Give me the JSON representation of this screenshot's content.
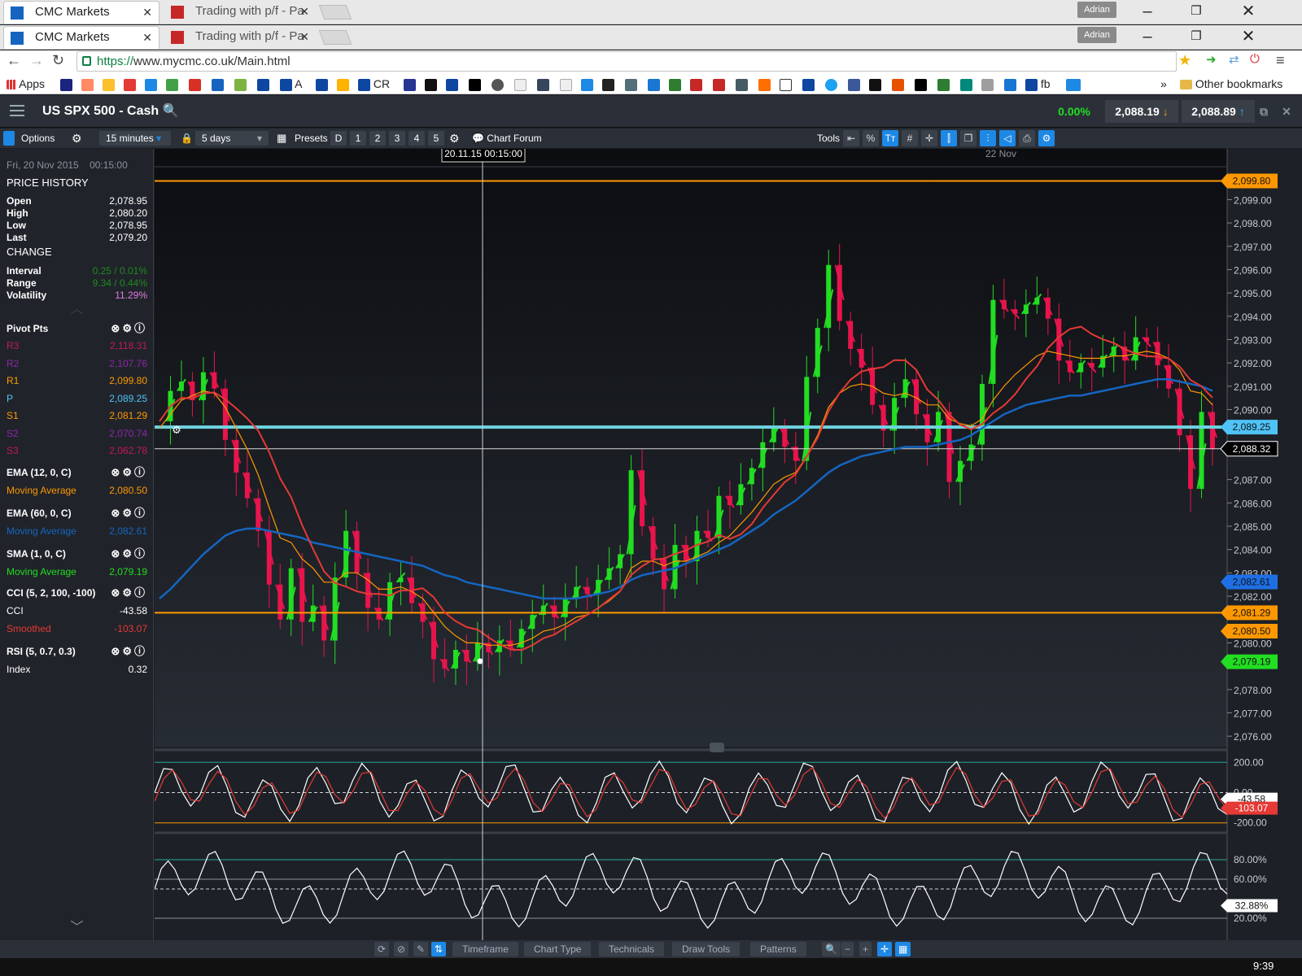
{
  "browser": {
    "tabs_top": [
      {
        "label": "CMC Markets",
        "active": true
      },
      {
        "label": "Trading with p/f - Pa",
        "active": false
      }
    ],
    "tabs_second": [
      {
        "label": "CMC Markets",
        "active": true
      },
      {
        "label": "Trading with p/f - Pa",
        "active": false
      }
    ],
    "user_badge": "Adrian",
    "url_scheme": "https://",
    "url_rest": "www.mycmc.co.uk/Main.html",
    "bookmarks": {
      "apps_label": "Apps",
      "a_label": "A",
      "cr_label": "CR",
      "fb_label": "fb",
      "more": "»",
      "other": "Other bookmarks"
    }
  },
  "app": {
    "instrument": "US SPX 500 - Cash",
    "change_pct": "0.00%",
    "sell_price": "2,088.19",
    "buy_price": "2,088.89",
    "colors": {
      "accent": "#1e88e5",
      "up": "#22dd22",
      "down": "#e8144c"
    }
  },
  "toolbar": {
    "options": "Options",
    "interval": "15 minutes",
    "range": "5 days",
    "presets": "Presets",
    "preset_buttons": [
      "D",
      "1",
      "2",
      "3",
      "4",
      "5"
    ],
    "chart_forum": "Chart Forum",
    "tools": "Tools"
  },
  "sidebar": {
    "date": "Fri, 20 Nov 2015",
    "time": "00:15:00",
    "price_history": "PRICE HISTORY",
    "ohlc": [
      {
        "label": "Open",
        "value": "2,078.95"
      },
      {
        "label": "High",
        "value": "2,080.20"
      },
      {
        "label": "Low",
        "value": "2,078.95"
      },
      {
        "label": "Last",
        "value": "2,079.20"
      }
    ],
    "change": "CHANGE",
    "stats": [
      {
        "label": "Interval",
        "value": "0.25 / 0.01%",
        "color": "#1f8a1f"
      },
      {
        "label": "Range",
        "value": "9.34 / 0.44%",
        "color": "#1f8a1f"
      },
      {
        "label": "Volatility",
        "value": "11.29%",
        "color": "#e07ae0"
      }
    ],
    "pivot_title": "Pivot Pts",
    "pivots": [
      {
        "label": "R3",
        "value": "2,118.31",
        "color": "#c2185b"
      },
      {
        "label": "R2",
        "value": "2,107.76",
        "color": "#8e24aa"
      },
      {
        "label": "R1",
        "value": "2,099.80",
        "color": "#ff9800"
      },
      {
        "label": "P",
        "value": "2,089.25",
        "color": "#4fc3f7"
      },
      {
        "label": "S1",
        "value": "2,081.29",
        "color": "#ff9800"
      },
      {
        "label": "S2",
        "value": "2,070.74",
        "color": "#8e24aa"
      },
      {
        "label": "S3",
        "value": "2,062.78",
        "color": "#c2185b"
      }
    ],
    "indicators": [
      {
        "title": "EMA (12, 0, C)",
        "label": "Moving Average",
        "value": "2,080.50",
        "color": "#ff9800"
      },
      {
        "title": "EMA (60, 0, C)",
        "label": "Moving Average",
        "value": "2,082.61",
        "color": "#1565c0"
      },
      {
        "title": "SMA (1, 0, C)",
        "label": "Moving Average",
        "value": "2,079.19",
        "color": "#22dd22"
      },
      {
        "title": "CCI (5, 2, 100, -100)",
        "label": "CCI",
        "value": "-43.58",
        "color": "#ffffff",
        "label2": "Smoothed",
        "value2": "-103.07",
        "color2": "#e53935"
      },
      {
        "title": "RSI (5, 0.7, 0.3)",
        "label": "Index",
        "value": "0.32",
        "color": "#ffffff"
      }
    ]
  },
  "chart_data": {
    "type": "line",
    "price_axis": [
      "2,099.00",
      "2,098.00",
      "2,097.00",
      "2,096.00",
      "2,095.00",
      "2,094.00",
      "2,093.00",
      "2,092.00",
      "2,091.00",
      "2,090.00",
      "2,087.00",
      "2,086.00",
      "2,085.00",
      "2,084.00",
      "2,083.00",
      "2,082.00",
      "2,080.00",
      "2,078.00",
      "2,077.00",
      "2,076.00"
    ],
    "ylim": [
      2075.9,
      2100.2
    ],
    "crosshair_label": "20.11.15 00:15:00",
    "day_label": "22 Nov",
    "price_tags": [
      {
        "value": "2,099.80",
        "price": 2099.8,
        "color": "#ff9800"
      },
      {
        "value": "2,089.25",
        "price": 2089.25,
        "color": "#4fc3f7"
      },
      {
        "value": "2,088.32",
        "price": 2088.32,
        "color": "#ffffff"
      },
      {
        "value": "2,082.61",
        "price": 2082.61,
        "color": "#1e6fe5"
      },
      {
        "value": "2,081.29",
        "price": 2081.29,
        "color": "#ff9800"
      },
      {
        "value": "2,080.50",
        "price": 2080.5,
        "color": "#ff9800"
      },
      {
        "value": "2,079.19",
        "price": 2079.19,
        "color": "#22dd22"
      }
    ],
    "series": [
      {
        "name": "SMA",
        "color": "#22dd22",
        "values": [
          2089.5,
          2090.8,
          2091.2,
          2090.4,
          2091.6,
          2090.9,
          2088.7,
          2087.3,
          2086.2,
          2084.8,
          2082.5,
          2081.0,
          2083.2,
          2080.9,
          2081.6,
          2080.1,
          2082.8,
          2084.8,
          2083.0,
          2081.5,
          2081.0,
          2082.6,
          2082.8,
          2081.7,
          2080.9,
          2079.3,
          2078.9,
          2079.7,
          2079.2,
          2080.0,
          2079.6,
          2080.1,
          2079.8,
          2080.6,
          2081.2,
          2081.6,
          2081.1,
          2081.9,
          2082.4,
          2082.1,
          2082.7,
          2083.2,
          2083.8,
          2087.4,
          2085.0,
          2083.6,
          2082.3,
          2084.2,
          2083.5,
          2084.8,
          2084.5,
          2086.3,
          2085.9,
          2086.8,
          2087.5,
          2088.6,
          2089.2,
          2088.4,
          2087.8,
          2091.4,
          2093.5,
          2096.2,
          2093.8,
          2092.6,
          2091.8,
          2090.2,
          2089.1,
          2090.5,
          2091.3,
          2089.8,
          2088.6,
          2089.9,
          2086.9,
          2087.8,
          2088.5,
          2091.1,
          2094.7,
          2094.3,
          2094.1,
          2094.5,
          2094.8,
          2093.9,
          2092.1,
          2091.6,
          2092.0,
          2091.8,
          2092.3,
          2092.7,
          2092.1,
          2093.1,
          2092.9,
          2091.9,
          2090.9,
          2088.9,
          2086.6,
          2089.9,
          2088.3
        ]
      },
      {
        "name": "EMA 12",
        "color": "#ff9800",
        "values": [
          2089.2,
          2089.8,
          2090.4,
          2090.6,
          2090.8,
          2090.7,
          2090.1,
          2089.2,
          2088.3,
          2087.2,
          2085.8,
          2084.5,
          2084.3,
          2083.6,
          2083.2,
          2082.6,
          2082.6,
          2083.0,
          2083.0,
          2082.7,
          2082.3,
          2082.3,
          2082.4,
          2082.2,
          2081.9,
          2081.3,
          2080.7,
          2080.3,
          2080.0,
          2080.0,
          2079.9,
          2079.9,
          2079.9,
          2080.0,
          2080.2,
          2080.5,
          2080.6,
          2080.8,
          2081.1,
          2081.2,
          2081.5,
          2081.8,
          2082.2,
          2083.2,
          2083.5,
          2083.5,
          2083.3,
          2083.5,
          2083.5,
          2083.7,
          2083.9,
          2084.3,
          2084.6,
          2085.1,
          2085.6,
          2086.2,
          2086.8,
          2087.1,
          2087.3,
          2088.0,
          2088.9,
          2090.1,
          2090.7,
          2091.0,
          2091.1,
          2091.0,
          2090.7,
          2090.6,
          2090.7,
          2090.5,
          2090.2,
          2090.2,
          2089.6,
          2089.4,
          2089.3,
          2089.6,
          2090.4,
          2091.0,
          2091.5,
          2091.9,
          2092.3,
          2092.5,
          2092.4,
          2092.3,
          2092.2,
          2092.2,
          2092.2,
          2092.3,
          2092.3,
          2092.4,
          2092.5,
          2092.4,
          2092.2,
          2091.7,
          2090.8,
          2090.7,
          2090.2
        ]
      },
      {
        "name": "EMA 60",
        "color": "#1565c0",
        "values": [
          2081.9,
          2082.3,
          2082.8,
          2083.3,
          2083.8,
          2084.2,
          2084.6,
          2084.8,
          2084.9,
          2084.9,
          2084.8,
          2084.7,
          2084.6,
          2084.5,
          2084.3,
          2084.2,
          2084.1,
          2084.0,
          2083.9,
          2083.8,
          2083.7,
          2083.6,
          2083.5,
          2083.4,
          2083.3,
          2083.1,
          2082.9,
          2082.8,
          2082.6,
          2082.5,
          2082.4,
          2082.3,
          2082.2,
          2082.1,
          2082.0,
          2081.9,
          2081.9,
          2081.9,
          2081.9,
          2082.0,
          2082.1,
          2082.2,
          2082.4,
          2082.7,
          2082.9,
          2083.0,
          2083.1,
          2083.2,
          2083.4,
          2083.6,
          2083.8,
          2084.0,
          2084.2,
          2084.5,
          2084.8,
          2085.1,
          2085.5,
          2085.8,
          2086.1,
          2086.5,
          2086.9,
          2087.3,
          2087.6,
          2087.8,
          2088.0,
          2088.1,
          2088.2,
          2088.3,
          2088.4,
          2088.4,
          2088.4,
          2088.5,
          2088.6,
          2088.7,
          2088.9,
          2089.2,
          2089.5,
          2089.8,
          2090.0,
          2090.2,
          2090.3,
          2090.4,
          2090.5,
          2090.6,
          2090.6,
          2090.7,
          2090.8,
          2090.9,
          2091.0,
          2091.1,
          2091.2,
          2091.3,
          2091.3,
          2091.2,
          2091.1,
          2091.0,
          2090.8
        ]
      }
    ],
    "cci_axis": [
      "200.00",
      "0.00",
      "-200.00"
    ],
    "cci_tags": [
      {
        "value": "-43.58",
        "color": "#ffffff"
      },
      {
        "value": "-103.07",
        "color": "#e53935"
      }
    ],
    "rsi_axis": [
      "80.00%",
      "60.00%",
      "20.00%"
    ],
    "rsi_tag": "32.88%"
  },
  "bottombar": {
    "tabs": [
      "Timeframe",
      "Chart Type",
      "Technicals",
      "Draw Tools",
      "Patterns"
    ]
  },
  "taskbar": {
    "clock": "9:39"
  }
}
